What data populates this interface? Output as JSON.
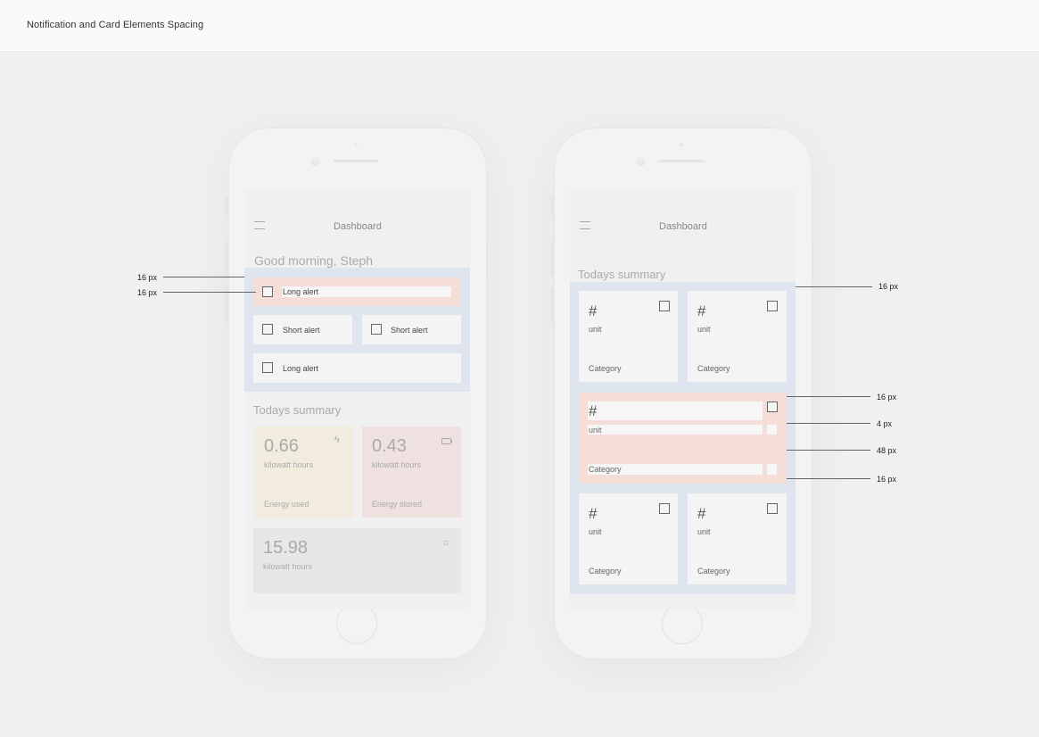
{
  "header": {
    "title": "Notification and Card Elements Spacing"
  },
  "left_phone": {
    "nav_title": "Dashboard",
    "greeting": "Good morning, Steph",
    "alerts": {
      "long1": "Long alert",
      "short1": "Short alert",
      "short2": "Short alert",
      "long2": "Long alert"
    },
    "summary_title": "Todays summary",
    "cards": [
      {
        "value": "0.66",
        "unit": "kilowatt hours",
        "label": "Energy used",
        "icon": "lightning-icon",
        "color": "#f1ecde"
      },
      {
        "value": "0.43",
        "unit": "kilowatt hours",
        "label": "Energy stored",
        "icon": "battery-icon",
        "color": "#eee1df"
      },
      {
        "value": "15.98",
        "unit": "kilowatt hours",
        "icon": "sun-icon",
        "color": "#e6e7e9"
      }
    ]
  },
  "right_phone": {
    "nav_title": "Dashboard",
    "summary_title": "Todays summary",
    "cards": [
      {
        "hash": "#",
        "unit": "unit",
        "category": "Category"
      },
      {
        "hash": "#",
        "unit": "unit",
        "category": "Category"
      },
      {
        "hash": "#",
        "unit": "unit",
        "category": "Category"
      },
      {
        "hash": "#",
        "unit": "unit",
        "category": "Category"
      },
      {
        "hash": "#",
        "unit": "unit",
        "category": "Category"
      }
    ]
  },
  "measurements": {
    "left_a": "16 px",
    "left_b": "16 px",
    "right_a": "16 px",
    "right_b": "16 px",
    "right_c": "4 px",
    "right_d": "48 px",
    "right_e": "16 px"
  },
  "colors": {
    "outer_highlight": "#dfe5ef",
    "inner_highlight": "#f5ddd8"
  }
}
